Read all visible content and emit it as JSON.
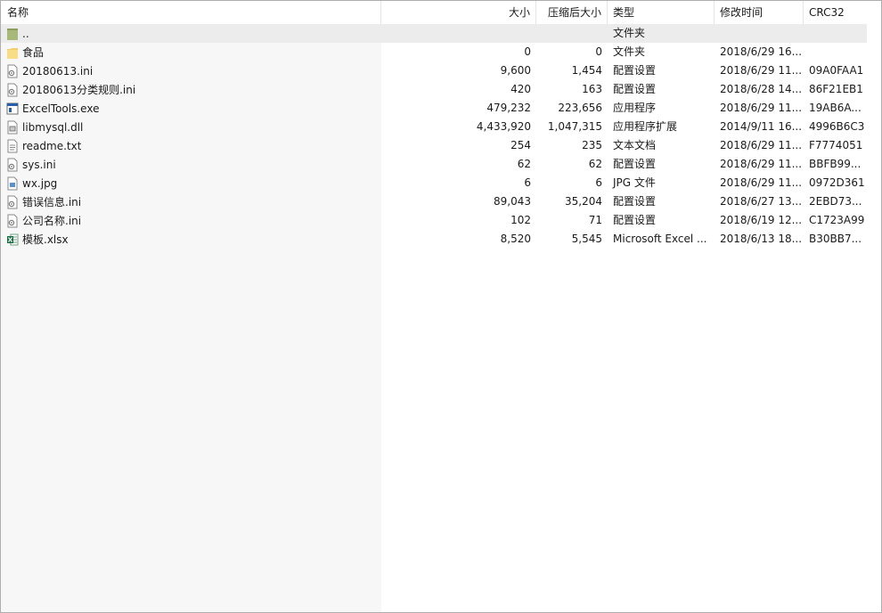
{
  "columns": {
    "name": "名称",
    "size": "大小",
    "packed": "压缩后大小",
    "type": "类型",
    "modified": "修改时间",
    "crc": "CRC32"
  },
  "sort_indicator": "^",
  "rows": [
    {
      "name": "..",
      "size": "",
      "packed": "",
      "type": "文件夹",
      "modified": "",
      "crc": "",
      "icon": "parent-folder-icon"
    },
    {
      "name": "食品",
      "size": "0",
      "packed": "0",
      "type": "文件夹",
      "modified": "2018/6/29 16...",
      "crc": "",
      "icon": "folder-icon"
    },
    {
      "name": "20180613.ini",
      "size": "9,600",
      "packed": "1,454",
      "type": "配置设置",
      "modified": "2018/6/29 11...",
      "crc": "09A0FAA1",
      "icon": "ini-file-icon"
    },
    {
      "name": "20180613分类规则.ini",
      "size": "420",
      "packed": "163",
      "type": "配置设置",
      "modified": "2018/6/28 14...",
      "crc": "86F21EB1",
      "icon": "ini-file-icon"
    },
    {
      "name": "ExcelTools.exe",
      "size": "479,232",
      "packed": "223,656",
      "type": "应用程序",
      "modified": "2018/6/29 11...",
      "crc": "19AB6A...",
      "icon": "exe-file-icon"
    },
    {
      "name": "libmysql.dll",
      "size": "4,433,920",
      "packed": "1,047,315",
      "type": "应用程序扩展",
      "modified": "2014/9/11 16...",
      "crc": "4996B6C3",
      "icon": "dll-file-icon"
    },
    {
      "name": "readme.txt",
      "size": "254",
      "packed": "235",
      "type": "文本文档",
      "modified": "2018/6/29 11...",
      "crc": "F7774051",
      "icon": "txt-file-icon"
    },
    {
      "name": "sys.ini",
      "size": "62",
      "packed": "62",
      "type": "配置设置",
      "modified": "2018/6/29 11...",
      "crc": "BBFB99...",
      "icon": "ini-file-icon"
    },
    {
      "name": "wx.jpg",
      "size": "6",
      "packed": "6",
      "type": "JPG 文件",
      "modified": "2018/6/29 11...",
      "crc": "0972D361",
      "icon": "jpg-file-icon"
    },
    {
      "name": "错误信息.ini",
      "size": "89,043",
      "packed": "35,204",
      "type": "配置设置",
      "modified": "2018/6/27 13...",
      "crc": "2EBD73...",
      "icon": "ini-file-icon"
    },
    {
      "name": "公司名称.ini",
      "size": "102",
      "packed": "71",
      "type": "配置设置",
      "modified": "2018/6/19 12...",
      "crc": "C1723A99",
      "icon": "ini-file-icon"
    },
    {
      "name": "模板.xlsx",
      "size": "8,520",
      "packed": "5,545",
      "type": "Microsoft Excel ...",
      "modified": "2018/6/13 18...",
      "crc": "B30BB7...",
      "icon": "xlsx-file-icon"
    }
  ],
  "colors": {
    "folder": "#f2cf6a",
    "parent_folder": "#a8b878",
    "excel": "#1d7044",
    "exe": "#2b5ea8",
    "row_selected_bg": "#ececec",
    "name_column_bg": "#f7f7f7"
  }
}
